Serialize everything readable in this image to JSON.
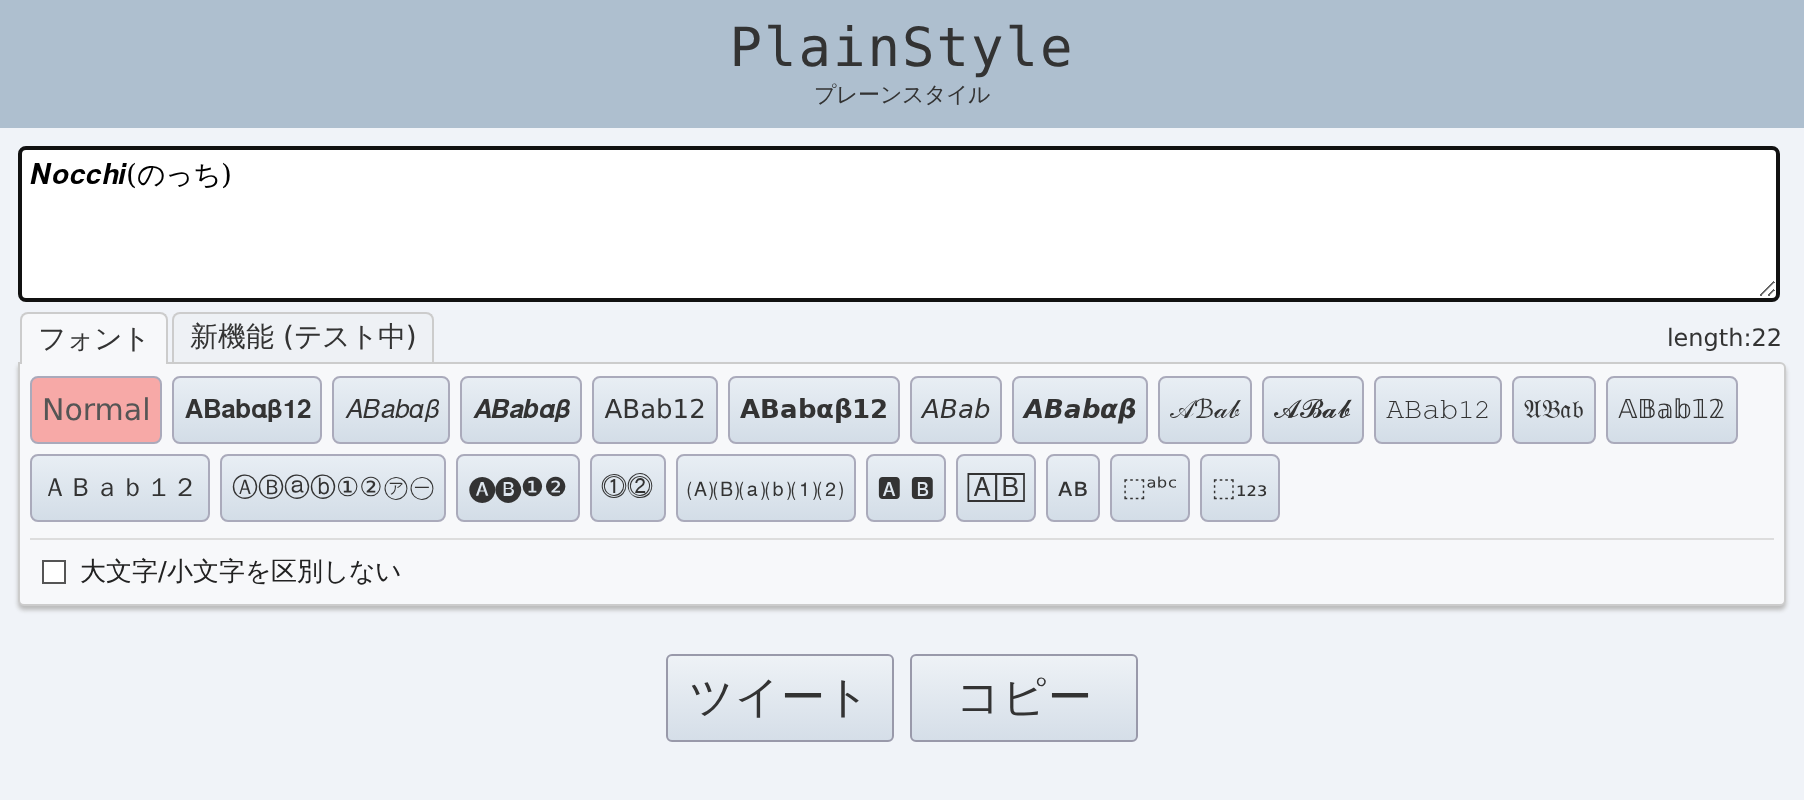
{
  "header": {
    "title": "PlainStyle",
    "subtitle": "プレーンスタイル"
  },
  "input": {
    "value": "𝑵𝒐𝒄𝒄𝒉𝒊(のっち)"
  },
  "tabs": [
    {
      "label": "フォント",
      "selected": true
    },
    {
      "label": "新機能 (テスト中)",
      "selected": false
    }
  ],
  "length": "length:22",
  "styles": [
    {
      "label": "Normal",
      "selected": true
    },
    {
      "label": "𝐀𝐁𝐚𝐛𝛂𝛃𝟏𝟐",
      "selected": false
    },
    {
      "label": "𝐴𝐵𝑎𝑏𝛼𝛽",
      "selected": false
    },
    {
      "label": "𝑨𝑩𝒂𝒃𝜶𝜷",
      "selected": false
    },
    {
      "label": "𝖠𝖡𝖺𝖻𝟣𝟤",
      "selected": false
    },
    {
      "label": "𝗔𝗕𝗮𝗯𝝰𝝱𝟭𝟮",
      "selected": false
    },
    {
      "label": "𝘈𝘉𝘢𝘣",
      "selected": false
    },
    {
      "label": "𝘼𝘽𝙖𝙗𝞪𝞫",
      "selected": false
    },
    {
      "label": "𝒜ℬ𝒶𝒷",
      "selected": false
    },
    {
      "label": "𝓐𝓑𝓪𝓫",
      "selected": false
    },
    {
      "label": "𝙰𝙱𝚊𝚋𝟷𝟸",
      "selected": false
    },
    {
      "label": "𝔄𝔅𝔞𝔟",
      "selected": false
    },
    {
      "label": "𝔸𝔹𝕒𝕓𝟙𝟚",
      "selected": false
    },
    {
      "label": "ＡＢａｂ１２",
      "selected": false
    },
    {
      "label": "ⒶⒷⓐⓑ①②㋐㊀",
      "selected": false
    },
    {
      "label": "🅐🅑❶❷",
      "selected": false
    },
    {
      "label": "⓵⓶",
      "selected": false
    },
    {
      "label": "🄐🄑⒜⒝⑴⑵",
      "selected": false
    },
    {
      "label": "🅰 🅱",
      "selected": false
    },
    {
      "label": "🄰🄱",
      "selected": false
    },
    {
      "label": "ᴀʙ",
      "selected": false
    },
    {
      "label": "⬚ᵃᵇᶜ",
      "selected": false
    },
    {
      "label": "⬚₁₂₃",
      "selected": false
    }
  ],
  "option": {
    "label": "大文字/小文字を区別しない",
    "checked": false
  },
  "buttons": [
    "ツイート",
    "コピー"
  ]
}
